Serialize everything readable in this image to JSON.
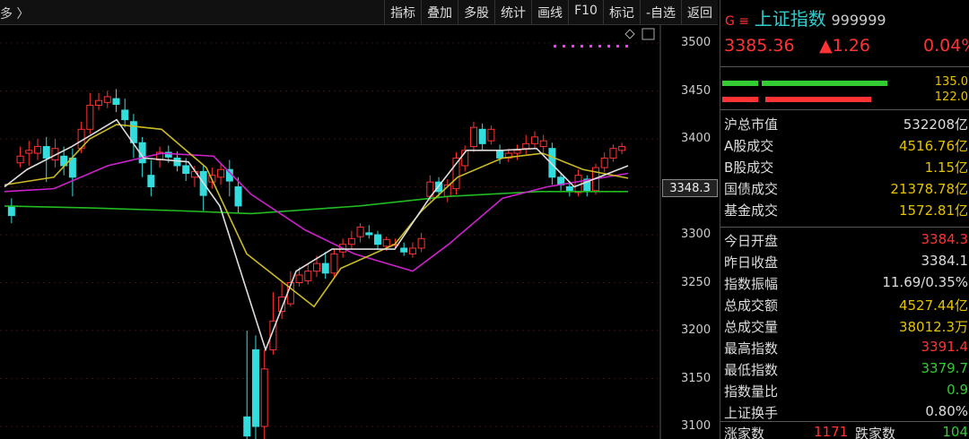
{
  "toolbar": {
    "crumb": "多 〉",
    "buttons": [
      "指标",
      "叠加",
      "多股",
      "统计",
      "画线",
      "F10",
      "标记",
      "-自选",
      "返回"
    ]
  },
  "chart_data": {
    "type": "candlestick",
    "ylim": [
      3080,
      3520
    ],
    "yticks": [
      3500,
      3450,
      3400,
      3350,
      3300,
      3250,
      3200,
      3150,
      3100
    ],
    "current_price_label": "3348.3",
    "candles": [
      [
        3330,
        3320,
        3338,
        3312
      ],
      [
        3375,
        3382,
        3392,
        3370
      ],
      [
        3385,
        3388,
        3398,
        3372
      ],
      [
        3385,
        3392,
        3400,
        3378
      ],
      [
        3392,
        3380,
        3402,
        3355
      ],
      [
        3378,
        3390,
        3400,
        3370
      ],
      [
        3382,
        3372,
        3392,
        3362
      ],
      [
        3380,
        3360,
        3390,
        3340
      ],
      [
        3390,
        3410,
        3418,
        3385
      ],
      [
        3410,
        3435,
        3448,
        3405
      ],
      [
        3435,
        3440,
        3448,
        3430
      ],
      [
        3438,
        3444,
        3450,
        3432
      ],
      [
        3442,
        3436,
        3452,
        3428
      ],
      [
        3430,
        3420,
        3442,
        3412
      ],
      [
        3418,
        3396,
        3426,
        3380
      ],
      [
        3396,
        3375,
        3402,
        3360
      ],
      [
        3362,
        3350,
        3378,
        3340
      ],
      [
        3378,
        3386,
        3392,
        3370
      ],
      [
        3386,
        3381,
        3393,
        3375
      ],
      [
        3380,
        3372,
        3387,
        3366
      ],
      [
        3372,
        3364,
        3380,
        3356
      ],
      [
        3360,
        3366,
        3372,
        3350
      ],
      [
        3366,
        3341,
        3372,
        3325
      ],
      [
        3355,
        3362,
        3370,
        3348
      ],
      [
        3360,
        3368,
        3374,
        3352
      ],
      [
        3368,
        3356,
        3378,
        3340
      ],
      [
        3350,
        3330,
        3360,
        3322
      ],
      [
        3110,
        3090,
        3200,
        3080
      ],
      [
        3180,
        3100,
        3195,
        3085
      ],
      [
        3100,
        3160,
        3180,
        3080
      ],
      [
        3180,
        3210,
        3240,
        3175
      ],
      [
        3220,
        3235,
        3250,
        3212
      ],
      [
        3228,
        3250,
        3262,
        3225
      ],
      [
        3250,
        3258,
        3266,
        3246
      ],
      [
        3252,
        3262,
        3270,
        3248
      ],
      [
        3262,
        3270,
        3278,
        3256
      ],
      [
        3270,
        3260,
        3282,
        3254
      ],
      [
        3260,
        3280,
        3286,
        3256
      ],
      [
        3282,
        3290,
        3296,
        3276
      ],
      [
        3290,
        3296,
        3304,
        3285
      ],
      [
        3298,
        3308,
        3312,
        3292
      ],
      [
        3302,
        3300,
        3310,
        3296
      ],
      [
        3300,
        3290,
        3304,
        3284
      ],
      [
        3288,
        3295,
        3298,
        3283
      ],
      [
        3290,
        3290,
        3296,
        3286
      ],
      [
        3286,
        3282,
        3292,
        3278
      ],
      [
        3280,
        3286,
        3292,
        3276
      ],
      [
        3286,
        3296,
        3302,
        3282
      ],
      [
        3340,
        3355,
        3362,
        3335
      ],
      [
        3355,
        3345,
        3360,
        3338
      ],
      [
        3340,
        3352,
        3358,
        3334
      ],
      [
        3348,
        3380,
        3386,
        3342
      ],
      [
        3372,
        3388,
        3393,
        3366
      ],
      [
        3392,
        3412,
        3418,
        3386
      ],
      [
        3410,
        3395,
        3416,
        3388
      ],
      [
        3398,
        3410,
        3414,
        3394
      ],
      [
        3388,
        3380,
        3394,
        3374
      ],
      [
        3380,
        3385,
        3390,
        3376
      ],
      [
        3385,
        3388,
        3394,
        3378
      ],
      [
        3390,
        3395,
        3404,
        3384
      ],
      [
        3395,
        3402,
        3408,
        3390
      ],
      [
        3392,
        3398,
        3404,
        3386
      ],
      [
        3390,
        3360,
        3396,
        3352
      ],
      [
        3360,
        3352,
        3364,
        3346
      ],
      [
        3350,
        3345,
        3356,
        3340
      ],
      [
        3344,
        3362,
        3368,
        3340
      ],
      [
        3358,
        3346,
        3362,
        3340
      ],
      [
        3346,
        3370,
        3374,
        3342
      ],
      [
        3370,
        3380,
        3386,
        3365
      ],
      [
        3380,
        3390,
        3394,
        3376
      ],
      [
        3388,
        3392,
        3396,
        3384
      ]
    ],
    "ma_white": [
      [
        5,
        3350
      ],
      [
        30,
        3368
      ],
      [
        80,
        3392
      ],
      [
        130,
        3420
      ],
      [
        160,
        3380
      ],
      [
        210,
        3376
      ],
      [
        245,
        3330
      ],
      [
        296,
        3180
      ],
      [
        330,
        3262
      ],
      [
        370,
        3285
      ],
      [
        440,
        3285
      ],
      [
        480,
        3340
      ],
      [
        520,
        3388
      ],
      [
        560,
        3388
      ],
      [
        598,
        3390
      ],
      [
        640,
        3350
      ],
      [
        700,
        3372
      ]
    ],
    "ma_yellow": [
      [
        5,
        3352
      ],
      [
        60,
        3360
      ],
      [
        100,
        3400
      ],
      [
        130,
        3415
      ],
      [
        180,
        3410
      ],
      [
        230,
        3370
      ],
      [
        275,
        3280
      ],
      [
        350,
        3225
      ],
      [
        380,
        3265
      ],
      [
        440,
        3290
      ],
      [
        470,
        3325
      ],
      [
        510,
        3360
      ],
      [
        560,
        3380
      ],
      [
        605,
        3385
      ],
      [
        650,
        3368
      ],
      [
        700,
        3359
      ]
    ],
    "ma_magenta": [
      [
        5,
        3345
      ],
      [
        60,
        3348
      ],
      [
        120,
        3372
      ],
      [
        180,
        3385
      ],
      [
        238,
        3382
      ],
      [
        280,
        3342
      ],
      [
        340,
        3305
      ],
      [
        395,
        3280
      ],
      [
        460,
        3262
      ],
      [
        500,
        3290
      ],
      [
        560,
        3338
      ],
      [
        610,
        3350
      ],
      [
        700,
        3364
      ]
    ],
    "ma_green": [
      [
        5,
        3330
      ],
      [
        100,
        3328
      ],
      [
        200,
        3325
      ],
      [
        280,
        3322
      ],
      [
        400,
        3330
      ],
      [
        500,
        3340
      ],
      [
        600,
        3345
      ],
      [
        700,
        3345
      ]
    ]
  },
  "panel": {
    "index_marker": "G ≡",
    "index_name": "上证指数",
    "index_code": "999999",
    "price": "3385.36",
    "change": "▲1.26",
    "change_pct": "0.04%",
    "bar_up_value": "135.0",
    "bar_down_value": "122.0",
    "rows": [
      {
        "label": "沪总市值",
        "value": "532208亿",
        "color": "#dddddd"
      },
      {
        "label": "A股成交",
        "value": "4516.76亿",
        "color": "#e6c300"
      },
      {
        "label": "B股成交",
        "value": "1.15亿",
        "color": "#e6c300"
      },
      {
        "label": "国债成交",
        "value": "21378.78亿",
        "color": "#e6c300"
      },
      {
        "label": "基金成交",
        "value": "1572.81亿",
        "color": "#e6c300"
      },
      {
        "label": "今日开盘",
        "value": "3384.3",
        "color": "#ff3333"
      },
      {
        "label": "昨日收盘",
        "value": "3384.1",
        "color": "#dddddd"
      },
      {
        "label": "指数振幅",
        "value": "11.69/0.35%",
        "color": "#dddddd"
      },
      {
        "label": "总成交额",
        "value": "4527.44亿",
        "color": "#e6c300"
      },
      {
        "label": "总成交量",
        "value": "38012.3万",
        "color": "#e6c300"
      },
      {
        "label": "最高指数",
        "value": "3391.4",
        "color": "#ff3333"
      },
      {
        "label": "最低指数",
        "value": "3379.7",
        "color": "#33cc33"
      },
      {
        "label": "指数量比",
        "value": "0.9",
        "color": "#33cc33"
      },
      {
        "label": "上证换手",
        "value": "0.80%",
        "color": "#dddddd"
      }
    ],
    "bottom": {
      "up_label": "涨家数",
      "up_value": "1171",
      "down_label": "跌家数",
      "down_value": "104"
    },
    "colors": {
      "up": "#ff3333",
      "down": "#33cccc",
      "title": "#33cccc",
      "yellow": "#e6c300",
      "green": "#33cc33"
    }
  }
}
